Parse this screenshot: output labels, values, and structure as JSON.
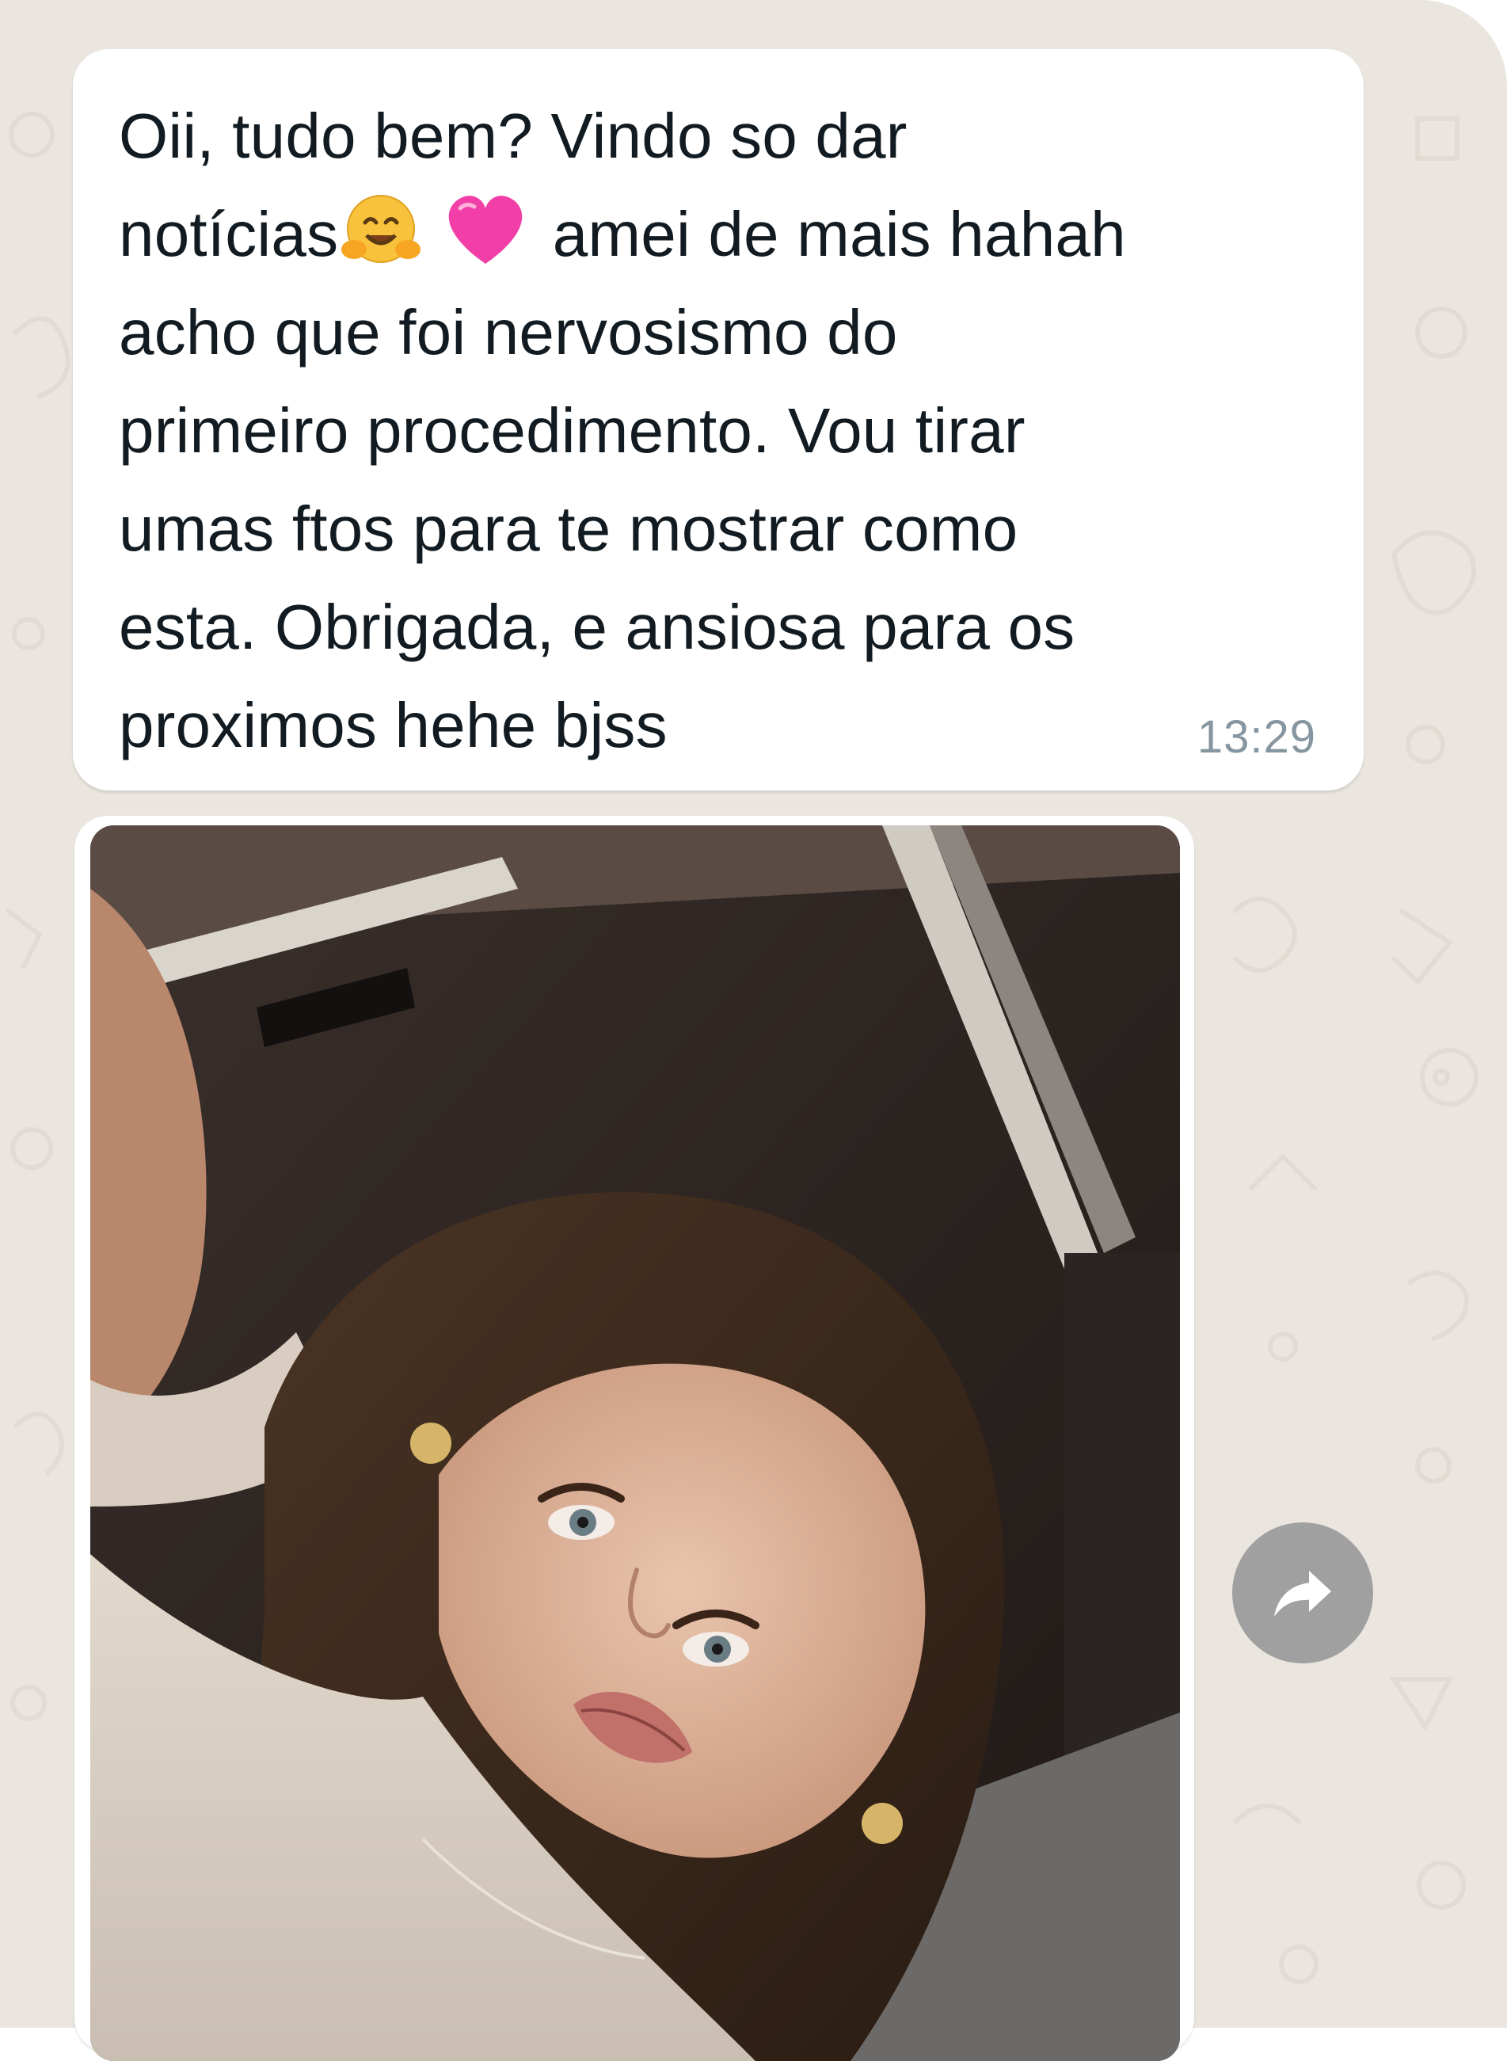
{
  "message": {
    "lines": [
      "Oii, tudo bem? Vindo so dar",
      "notícias",
      " amei de mais hahah",
      "acho que foi nervosismo do",
      "primeiro procedimento. Vou tirar",
      "umas ftos para te mostrar como",
      "esta. Obrigada, e ansiosa para os",
      "proximos hehe bjss"
    ],
    "emojis": [
      "hugging-face",
      "pink-heart"
    ],
    "time": "13:29"
  },
  "photo_message": {
    "image": "selfie-photo",
    "forward_icon": "forward-arrow-icon"
  },
  "colors": {
    "chat_background": "#eae6df",
    "bubble": "#ffffff",
    "text": "#111b21",
    "timestamp": "#8696a0",
    "forward_button": "#a0a0a0"
  }
}
